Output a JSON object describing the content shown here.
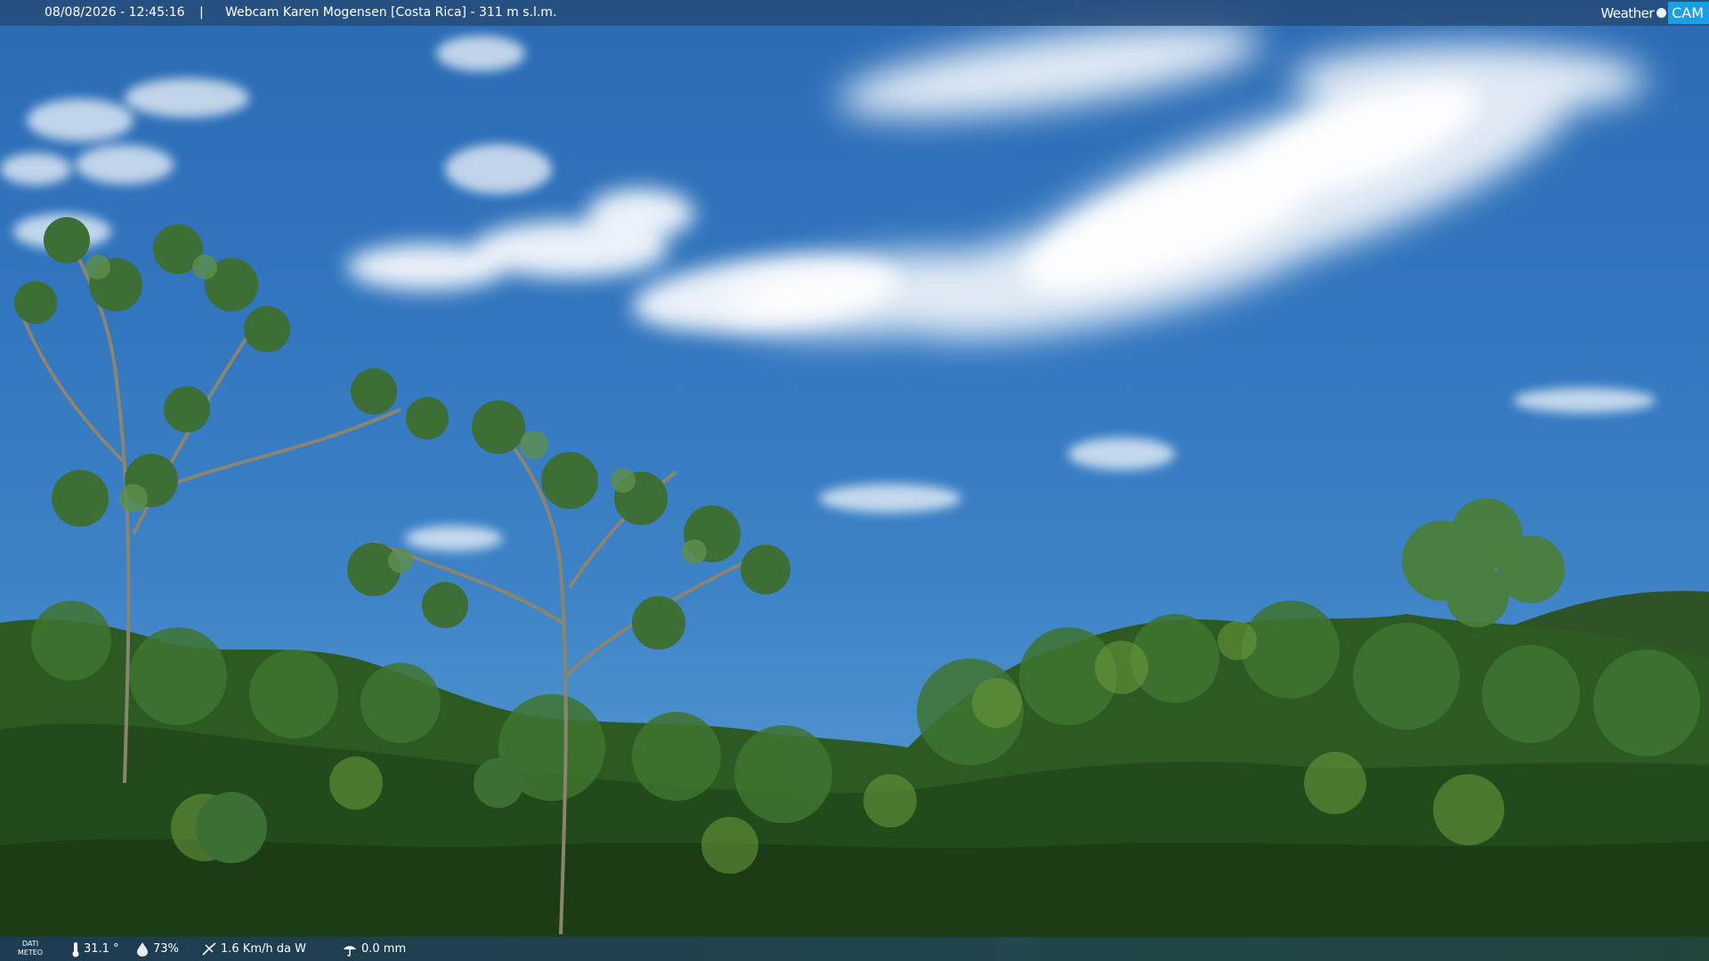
{
  "overlay": {
    "datetime": "08/08/2026 - 12:45:16",
    "separator": "|",
    "title": "Webcam Karen Mogensen [Costa Rica] - 311 m s.l.m."
  },
  "logo": {
    "weather": "Weather",
    "cam": "CAM"
  },
  "meteo": {
    "label_line1": "DATI",
    "label_line2": "METEO",
    "temperature": "31.1 °",
    "humidity": "73%",
    "wind": "1.6 Km/h da W",
    "rain": "0.0 mm"
  },
  "colors": {
    "sky_top": "#2b6bb4",
    "sky_bottom": "#5a9bd3",
    "foliage_dark": "#1f3a1a",
    "foliage_mid": "#3c6b2c",
    "foliage_light": "#6f9a45",
    "logo_accent": "#1a9ee6"
  },
  "icons": {
    "temperature": "thermometer-icon",
    "humidity": "droplet-icon",
    "wind": "wind-icon",
    "rain": "rain-icon"
  }
}
